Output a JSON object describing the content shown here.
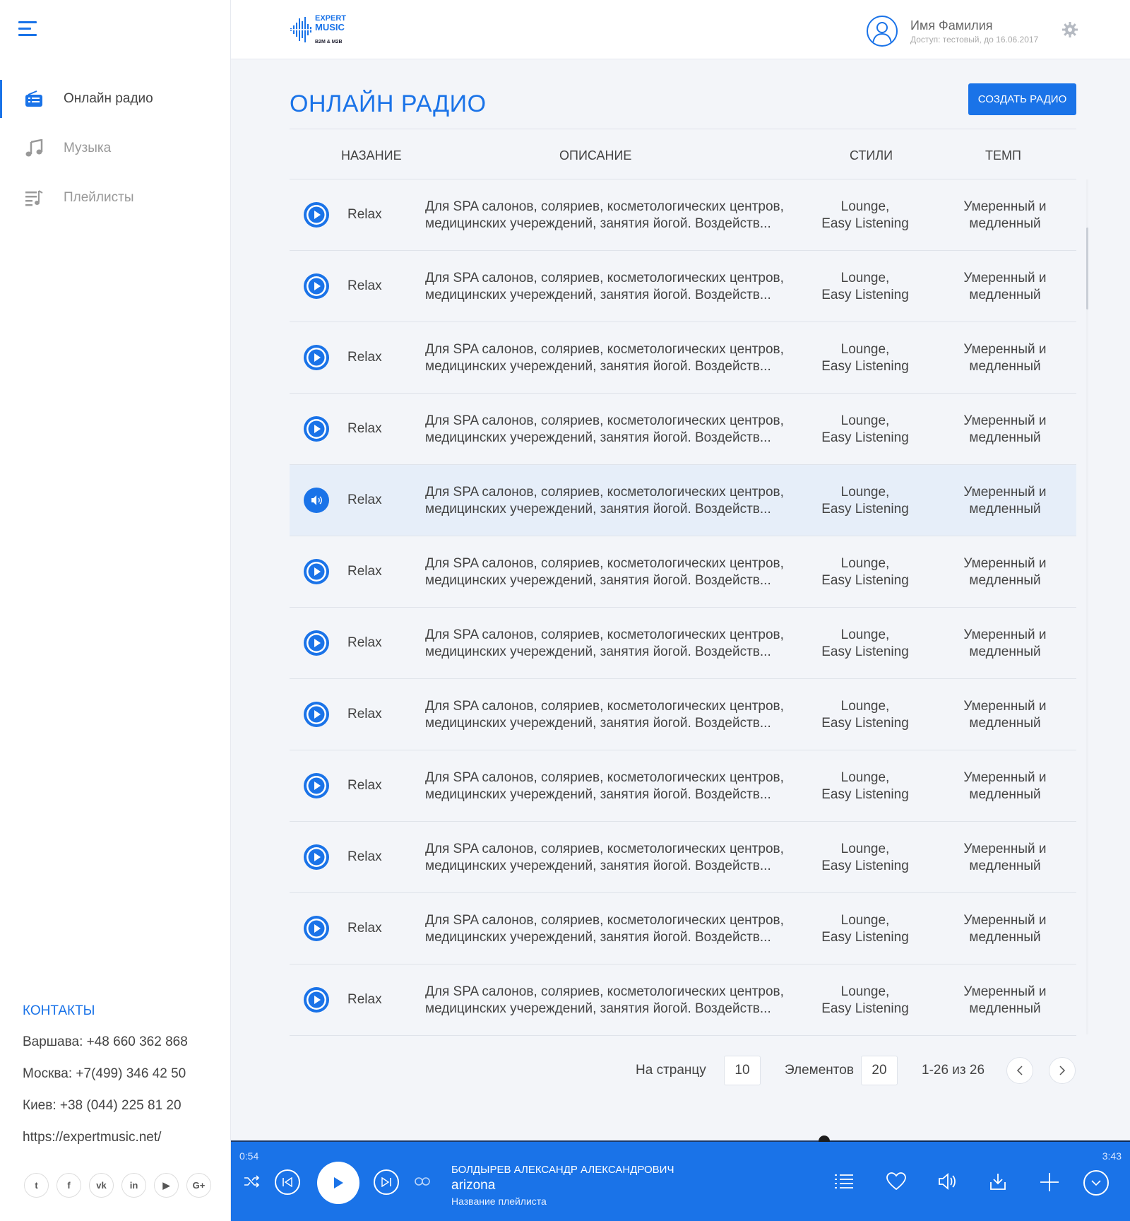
{
  "sidebar": {
    "nav": [
      {
        "label": "Онлайн радио",
        "icon": "radio-icon",
        "active": true
      },
      {
        "label": "Музыка",
        "icon": "music-note-icon",
        "active": false
      },
      {
        "label": "Плейлисты",
        "icon": "playlist-icon",
        "active": false
      }
    ],
    "contacts": {
      "title": "КОНТАКТЫ",
      "lines": [
        "Варшава:  +48 660 362 868",
        "Москва:  +7(499) 346 42 50",
        "Киев: +38 (044) 225 81 20",
        "https://expertmusic.net/"
      ]
    },
    "social": [
      {
        "icon": "twitter-icon",
        "glyph": "t"
      },
      {
        "icon": "facebook-icon",
        "glyph": "f"
      },
      {
        "icon": "vk-icon",
        "glyph": "vk"
      },
      {
        "icon": "linkedin-icon",
        "glyph": "in"
      },
      {
        "icon": "youtube-icon",
        "glyph": "▶"
      },
      {
        "icon": "google-plus-icon",
        "glyph": "G+"
      }
    ]
  },
  "header": {
    "logo_line1": "EXPERT",
    "logo_line2": "MUSIC",
    "logo_sub": "B2M & M2B",
    "user_name": "Имя Фамилия",
    "user_access": "Доступ: тестовый, до 16.06.2017"
  },
  "main": {
    "title": "ОНЛАЙН РАДИО",
    "create_button": "СОЗДАТЬ РАДИО",
    "columns": {
      "name": "НАЗАНИЕ",
      "description": "ОПИСАНИЕ",
      "styles": "СТИЛИ",
      "tempo": "ТЕМП"
    },
    "rows": [
      {
        "name": "Relax",
        "desc1": "Для SPA салонов, соляриев, косметологических центров,",
        "desc2": "медицинских учереждений, занятия йогой. Воздейств...",
        "style1": "Lounge,",
        "style2": "Easy Listening",
        "tempo1": "Умеренный и",
        "tempo2": "медленный",
        "playing": false
      },
      {
        "name": "Relax",
        "desc1": "Для SPA салонов, соляриев, косметологических центров,",
        "desc2": "медицинских учереждений, занятия йогой. Воздейств...",
        "style1": "Lounge,",
        "style2": "Easy Listening",
        "tempo1": "Умеренный и",
        "tempo2": "медленный",
        "playing": false
      },
      {
        "name": "Relax",
        "desc1": "Для SPA салонов, соляриев, косметологических центров,",
        "desc2": "медицинских учереждений, занятия йогой. Воздейств...",
        "style1": "Lounge,",
        "style2": "Easy Listening",
        "tempo1": "Умеренный и",
        "tempo2": "медленный",
        "playing": false
      },
      {
        "name": "Relax",
        "desc1": "Для SPA салонов, соляриев, косметологических центров,",
        "desc2": "медицинских учереждений, занятия йогой. Воздейств...",
        "style1": "Lounge,",
        "style2": "Easy Listening",
        "tempo1": "Умеренный и",
        "tempo2": "медленный",
        "playing": false
      },
      {
        "name": "Relax",
        "desc1": "Для SPA салонов, соляриев, косметологических центров,",
        "desc2": "медицинских учереждений, занятия йогой. Воздейств...",
        "style1": "Lounge,",
        "style2": "Easy Listening",
        "tempo1": "Умеренный и",
        "tempo2": "медленный",
        "playing": true
      },
      {
        "name": "Relax",
        "desc1": "Для SPA салонов, соляриев, косметологических центров,",
        "desc2": "медицинских учереждений, занятия йогой. Воздейств...",
        "style1": "Lounge,",
        "style2": "Easy Listening",
        "tempo1": "Умеренный и",
        "tempo2": "медленный",
        "playing": false
      },
      {
        "name": "Relax",
        "desc1": "Для SPA салонов, соляриев, косметологических центров,",
        "desc2": "медицинских учереждений, занятия йогой. Воздейств...",
        "style1": "Lounge,",
        "style2": "Easy Listening",
        "tempo1": "Умеренный и",
        "tempo2": "медленный",
        "playing": false
      },
      {
        "name": "Relax",
        "desc1": "Для SPA салонов, соляриев, косметологических центров,",
        "desc2": "медицинских учереждений, занятия йогой. Воздейств...",
        "style1": "Lounge,",
        "style2": "Easy Listening",
        "tempo1": "Умеренный и",
        "tempo2": "медленный",
        "playing": false
      },
      {
        "name": "Relax",
        "desc1": "Для SPA салонов, соляриев, косметологических центров,",
        "desc2": "медицинских учереждений, занятия йогой. Воздейств...",
        "style1": "Lounge,",
        "style2": "Easy Listening",
        "tempo1": "Умеренный и",
        "tempo2": "медленный",
        "playing": false
      },
      {
        "name": "Relax",
        "desc1": "Для SPA салонов, соляриев, косметологических центров,",
        "desc2": "медицинских учереждений, занятия йогой. Воздейств...",
        "style1": "Lounge,",
        "style2": "Easy Listening",
        "tempo1": "Умеренный и",
        "tempo2": "медленный",
        "playing": false
      },
      {
        "name": "Relax",
        "desc1": "Для SPA салонов, соляриев, косметологических центров,",
        "desc2": "медицинских учереждений, занятия йогой. Воздейств...",
        "style1": "Lounge,",
        "style2": "Easy Listening",
        "tempo1": "Умеренный и",
        "tempo2": "медленный",
        "playing": false
      },
      {
        "name": "Relax",
        "desc1": "Для SPA салонов, соляриев, косметологических центров,",
        "desc2": "медицинских учереждений, занятия йогой. Воздейств...",
        "style1": "Lounge,",
        "style2": "Easy Listening",
        "tempo1": "Умеренный и",
        "tempo2": "медленный",
        "playing": false
      }
    ],
    "pagination": {
      "per_page_label": "На странцу",
      "per_page_value": "10",
      "elements_label": "Элементов",
      "elements_value": "20",
      "range": "1-26 из 26"
    }
  },
  "player": {
    "time_current": "0:54",
    "time_total": "3:43",
    "progress": 0.66,
    "artist": "БОЛДЫРЕВ АЛЕКСАНДР АЛЕКСАНДРОВИЧ",
    "title": "arizona",
    "playlist": "Название плейлиста"
  },
  "colors": {
    "accent": "#1a73e8",
    "active_row": "#e6eef9"
  }
}
